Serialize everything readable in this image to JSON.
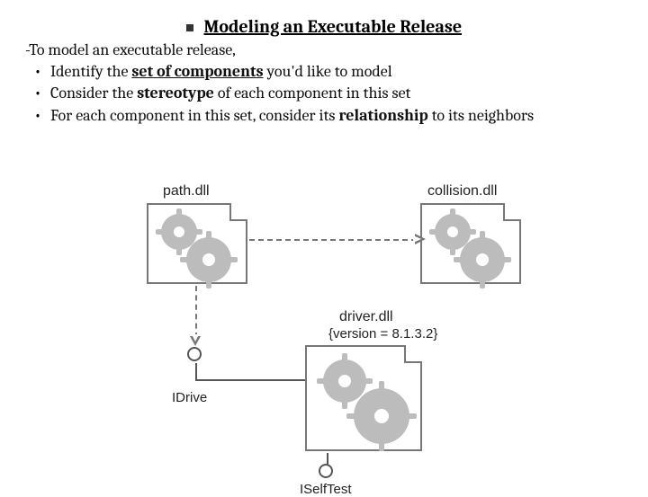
{
  "title_bullet": "■",
  "title": "Modeling an Executable Release",
  "intro": "-To model an executable release,",
  "bullets": [
    {
      "pre": "Identify the ",
      "em": "set of components",
      "post": " you'd like to model",
      "em_class": "b u"
    },
    {
      "pre": "Consider the ",
      "em": "stereotype",
      "post": " of each component in this set",
      "em_class": "b"
    },
    {
      "pre": "For each component in this set, consider its ",
      "em": "relationship",
      "post": " to its neighbors",
      "em_class": "b"
    }
  ],
  "diagram": {
    "components": {
      "path": {
        "label": "path.dll"
      },
      "collision": {
        "label": "collision.dll"
      },
      "driver": {
        "label": "driver.dll",
        "version": "{version = 8.1.3.2}"
      }
    },
    "interfaces": {
      "idrive": "IDrive",
      "iselftest": "ISelfTest"
    }
  }
}
